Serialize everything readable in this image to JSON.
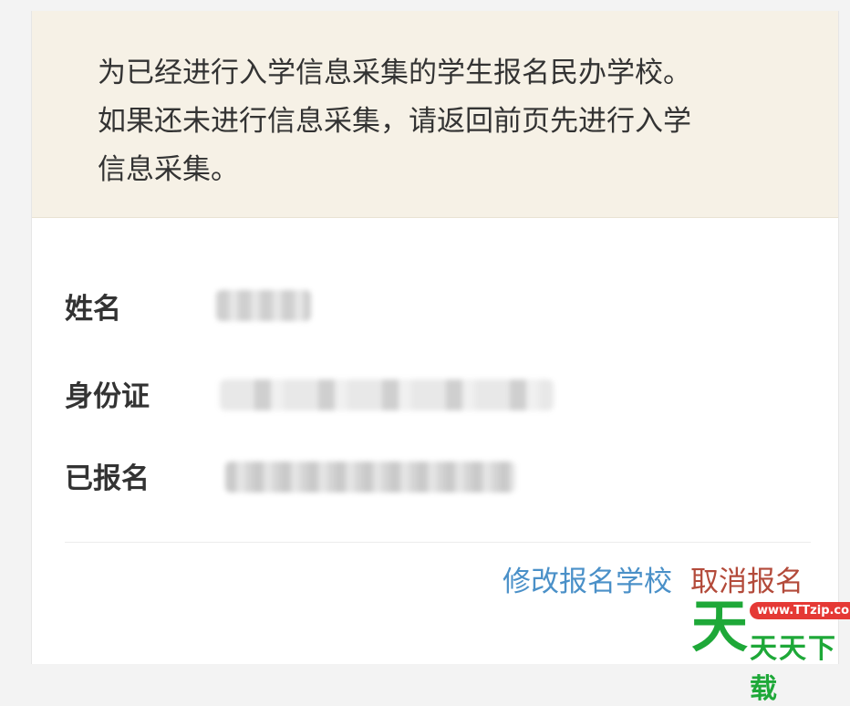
{
  "notice": {
    "line1": "为已经进行入学信息采集的学生报名民办学校。",
    "line2": "如果还未进行信息采集，请返回前页先进行入学",
    "line3": "信息采集。"
  },
  "fields": {
    "name_label": "姓名",
    "id_label": "身份证",
    "enrolled_label": "已报名"
  },
  "actions": {
    "edit_label": "修改报名学校",
    "cancel_label": "取消报名"
  },
  "watermark": {
    "big_char": "天",
    "url": "www.TTzip.com",
    "text": "天天下载"
  }
}
